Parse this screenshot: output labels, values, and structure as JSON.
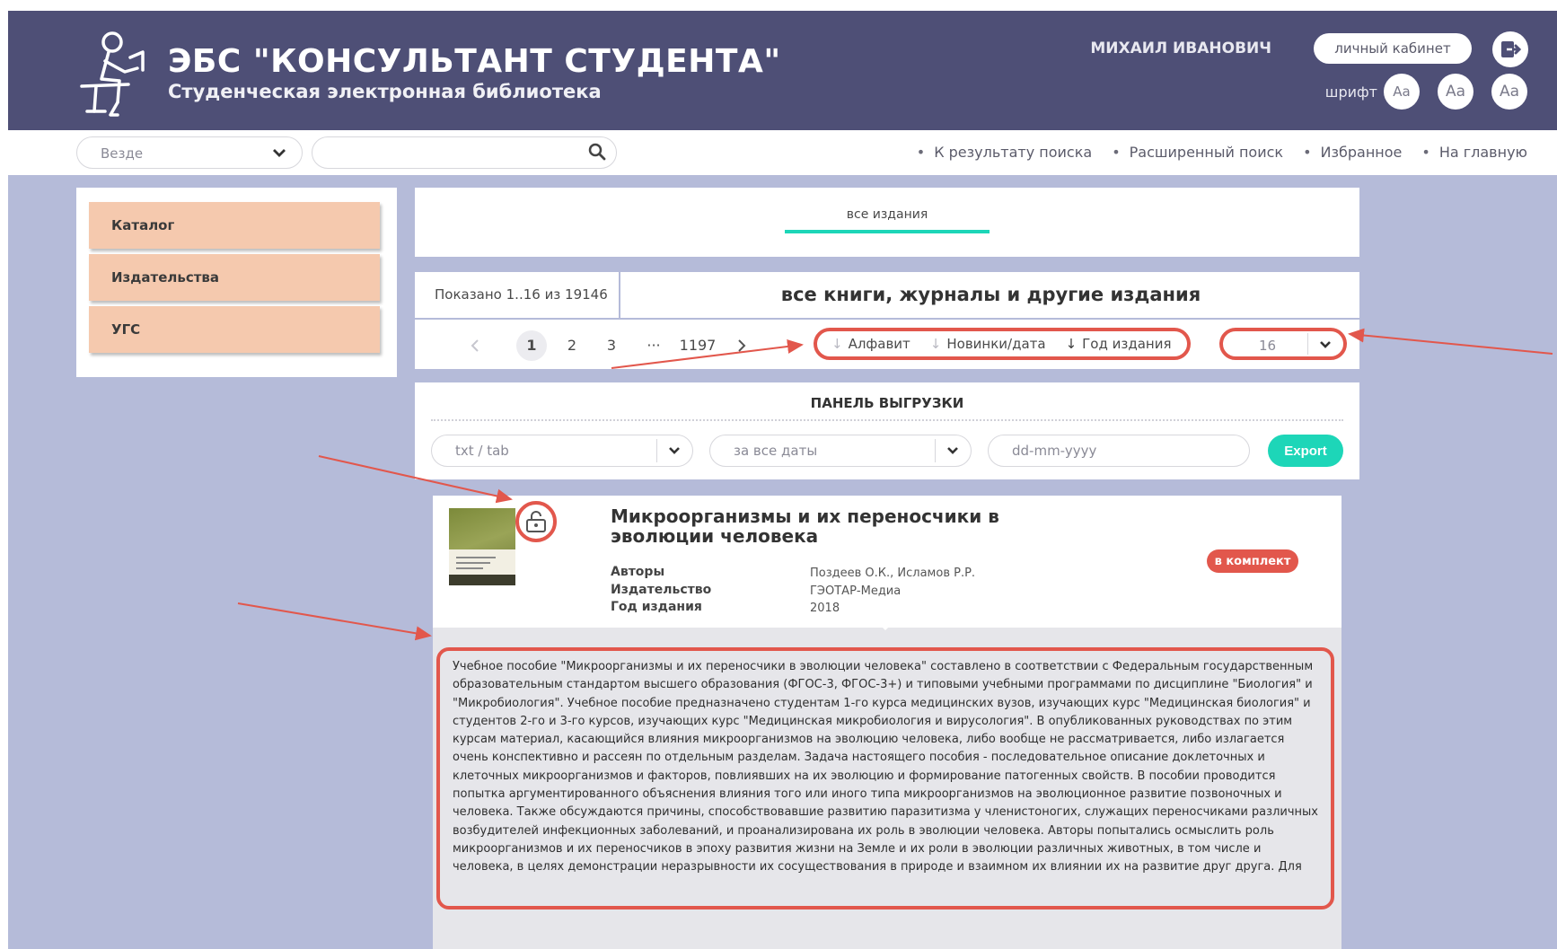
{
  "header": {
    "title": "ЭБС \"КОНСУЛЬТАНТ СТУДЕНТА\"",
    "subtitle": "Студенческая электронная библиотека",
    "user_name": "МИХАИЛ ИВАНОВИЧ",
    "cabinet_label": "личный кабинет",
    "font_label": "шрифт",
    "font_buttons": [
      "Aa",
      "Aa",
      "Aa"
    ]
  },
  "search": {
    "scope_value": "Везде",
    "query": ""
  },
  "top_nav": [
    "К результату поиска",
    "Расширенный поиск",
    "Избранное",
    "На главную"
  ],
  "sidebar": {
    "items": [
      "Каталог",
      "Издательства",
      "УГС"
    ]
  },
  "tabs": {
    "active": "все издания"
  },
  "results": {
    "count_text": "Показано 1..16 из 19146",
    "title": "все книги, журналы и другие издания"
  },
  "pagination": {
    "pages": [
      "1",
      "2",
      "3",
      "···",
      "1197"
    ],
    "current": "1"
  },
  "sort": {
    "options": [
      "Алфавит",
      "Новинки/дата",
      "Год издания"
    ],
    "active": "Год издания"
  },
  "per_page": "16",
  "export_panel": {
    "title": "ПАНЕЛЬ ВЫГРУЗКИ",
    "format_value": "txt / tab",
    "period_value": "за все даты",
    "date_placeholder": "dd-mm-yyyy",
    "button_label": "Export"
  },
  "book": {
    "title": "Микроорганизмы и их переносчики в эволюции человека",
    "authors_label": "Авторы",
    "authors": "Поздеев О.К., Исламов Р.Р.",
    "publisher_label": "Издательство",
    "publisher": "ГЭОТАР-Медиа",
    "year_label": "Год издания",
    "year": "2018",
    "badge": "в комплект",
    "description": "Учебное пособие \"Микроорганизмы и их переносчики в эволюции человека\" составлено в соответствии с Федеральным государственным образовательным стандартом высшего образования (ФГОС-3, ФГОС-3+) и типовыми учебными программами по дисциплине \"Биология\" и \"Микробиология\". Учебное пособие предназначено студентам 1-го курса медицинских вузов, изучающих курс \"Медицинская биология\" и студентов 2-го и 3-го курсов, изучающих курс \"Медицинская микробиология и вирусология\". В опубликованных руководствах по этим курсам материал, касающийся влияния микроорганизмов на эволюцию человека, либо вообще не рассматривается, либо излагается очень конспективно и рассеян по отдельным разделам. Задача настоящего пособия - последовательное описание доклеточных и клеточных микроорганизмов и факторов, повлиявших на их эволюцию и формирование патогенных свойств. В пособии проводится попытка аргументированного объяснения влияния того или иного типа микроорганизмов на эволюционное развитие позвоночных и человека. Также обсуждаются причины, способствовавшие развитию паразитизма у членистоногих, служащих переносчиками различных возбудителей инфекционных заболеваний, и проанализирована их роль в эволюции человека. Авторы попытались осмыслить роль микроорганизмов и их переносчиков в эпоху развития жизни на Земле и их роли в эволюции различных животных, в том числе и человека, в целях демонстрации неразрывности их сосуществования в природе и взаимном их влиянии их на развитие друг друга. Для"
  },
  "colors": {
    "header_bg": "#4e4f76",
    "page_bg": "#b5bbd9",
    "accent": "#1dd6b8",
    "highlight": "#e2574c",
    "menu_item": "#f5c9ae"
  },
  "icons": {
    "logo": "student-at-desk-icon",
    "logout": "logout-icon",
    "search": "search-icon",
    "lock": "open-lock-icon"
  }
}
